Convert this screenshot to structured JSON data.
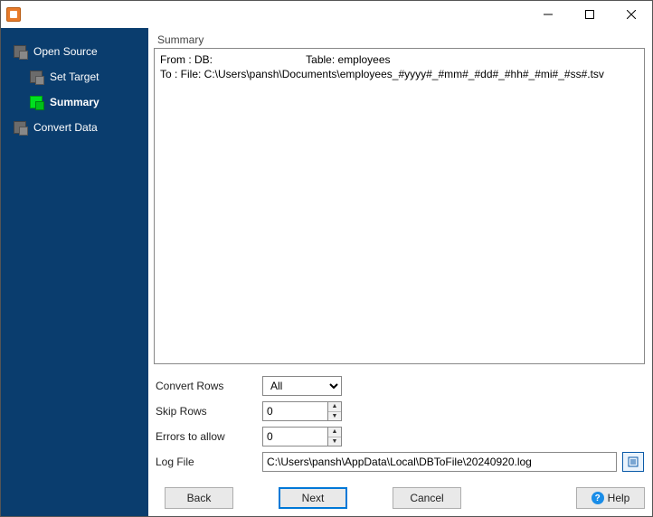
{
  "titlebar": {
    "title": ""
  },
  "sidebar": {
    "items": [
      {
        "label": "Open Source"
      },
      {
        "label": "Set Target"
      },
      {
        "label": "Summary"
      },
      {
        "label": "Convert Data"
      }
    ]
  },
  "summary": {
    "heading": "Summary",
    "line1": "From : DB:                               Table: employees",
    "line2": "To : File: C:\\Users\\pansh\\Documents\\employees_#yyyy#_#mm#_#dd#_#hh#_#mi#_#ss#.tsv"
  },
  "form": {
    "convert_rows": {
      "label": "Convert Rows",
      "value": "All"
    },
    "skip_rows": {
      "label": "Skip Rows",
      "value": "0"
    },
    "errors_allow": {
      "label": "Errors to allow",
      "value": "0"
    },
    "log_file": {
      "label": "Log File",
      "value": "C:\\Users\\pansh\\AppData\\Local\\DBToFile\\20240920.log"
    }
  },
  "buttons": {
    "back": "Back",
    "next": "Next",
    "cancel": "Cancel",
    "help": "Help"
  }
}
